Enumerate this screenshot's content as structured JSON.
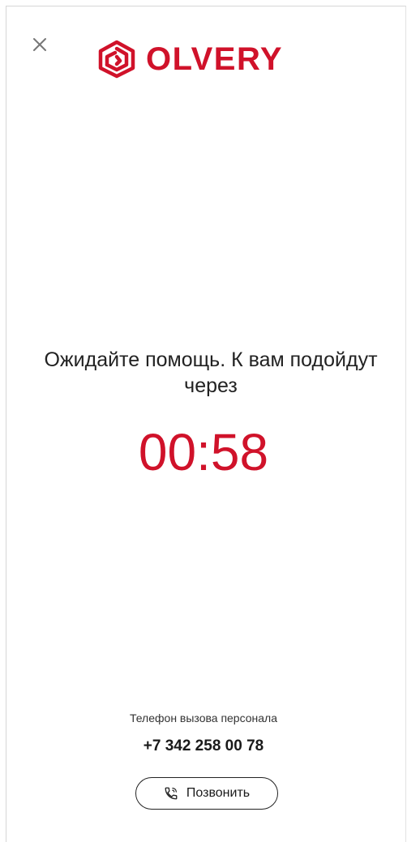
{
  "header": {
    "brand_name": "OLVERY",
    "close_icon": "close-icon",
    "logo_icon": "olvery-logo-icon",
    "brand_color": "#d0122a"
  },
  "main": {
    "message": "Ожидайте помощь. К вам подойдут через",
    "timer": "00:58",
    "timer_color": "#d0122a"
  },
  "footer": {
    "phone_caption": "Телефон вызова персонала",
    "phone_number": "+7 342 258 00 78",
    "call_button_label": "Позвонить",
    "call_icon": "phone-icon"
  }
}
